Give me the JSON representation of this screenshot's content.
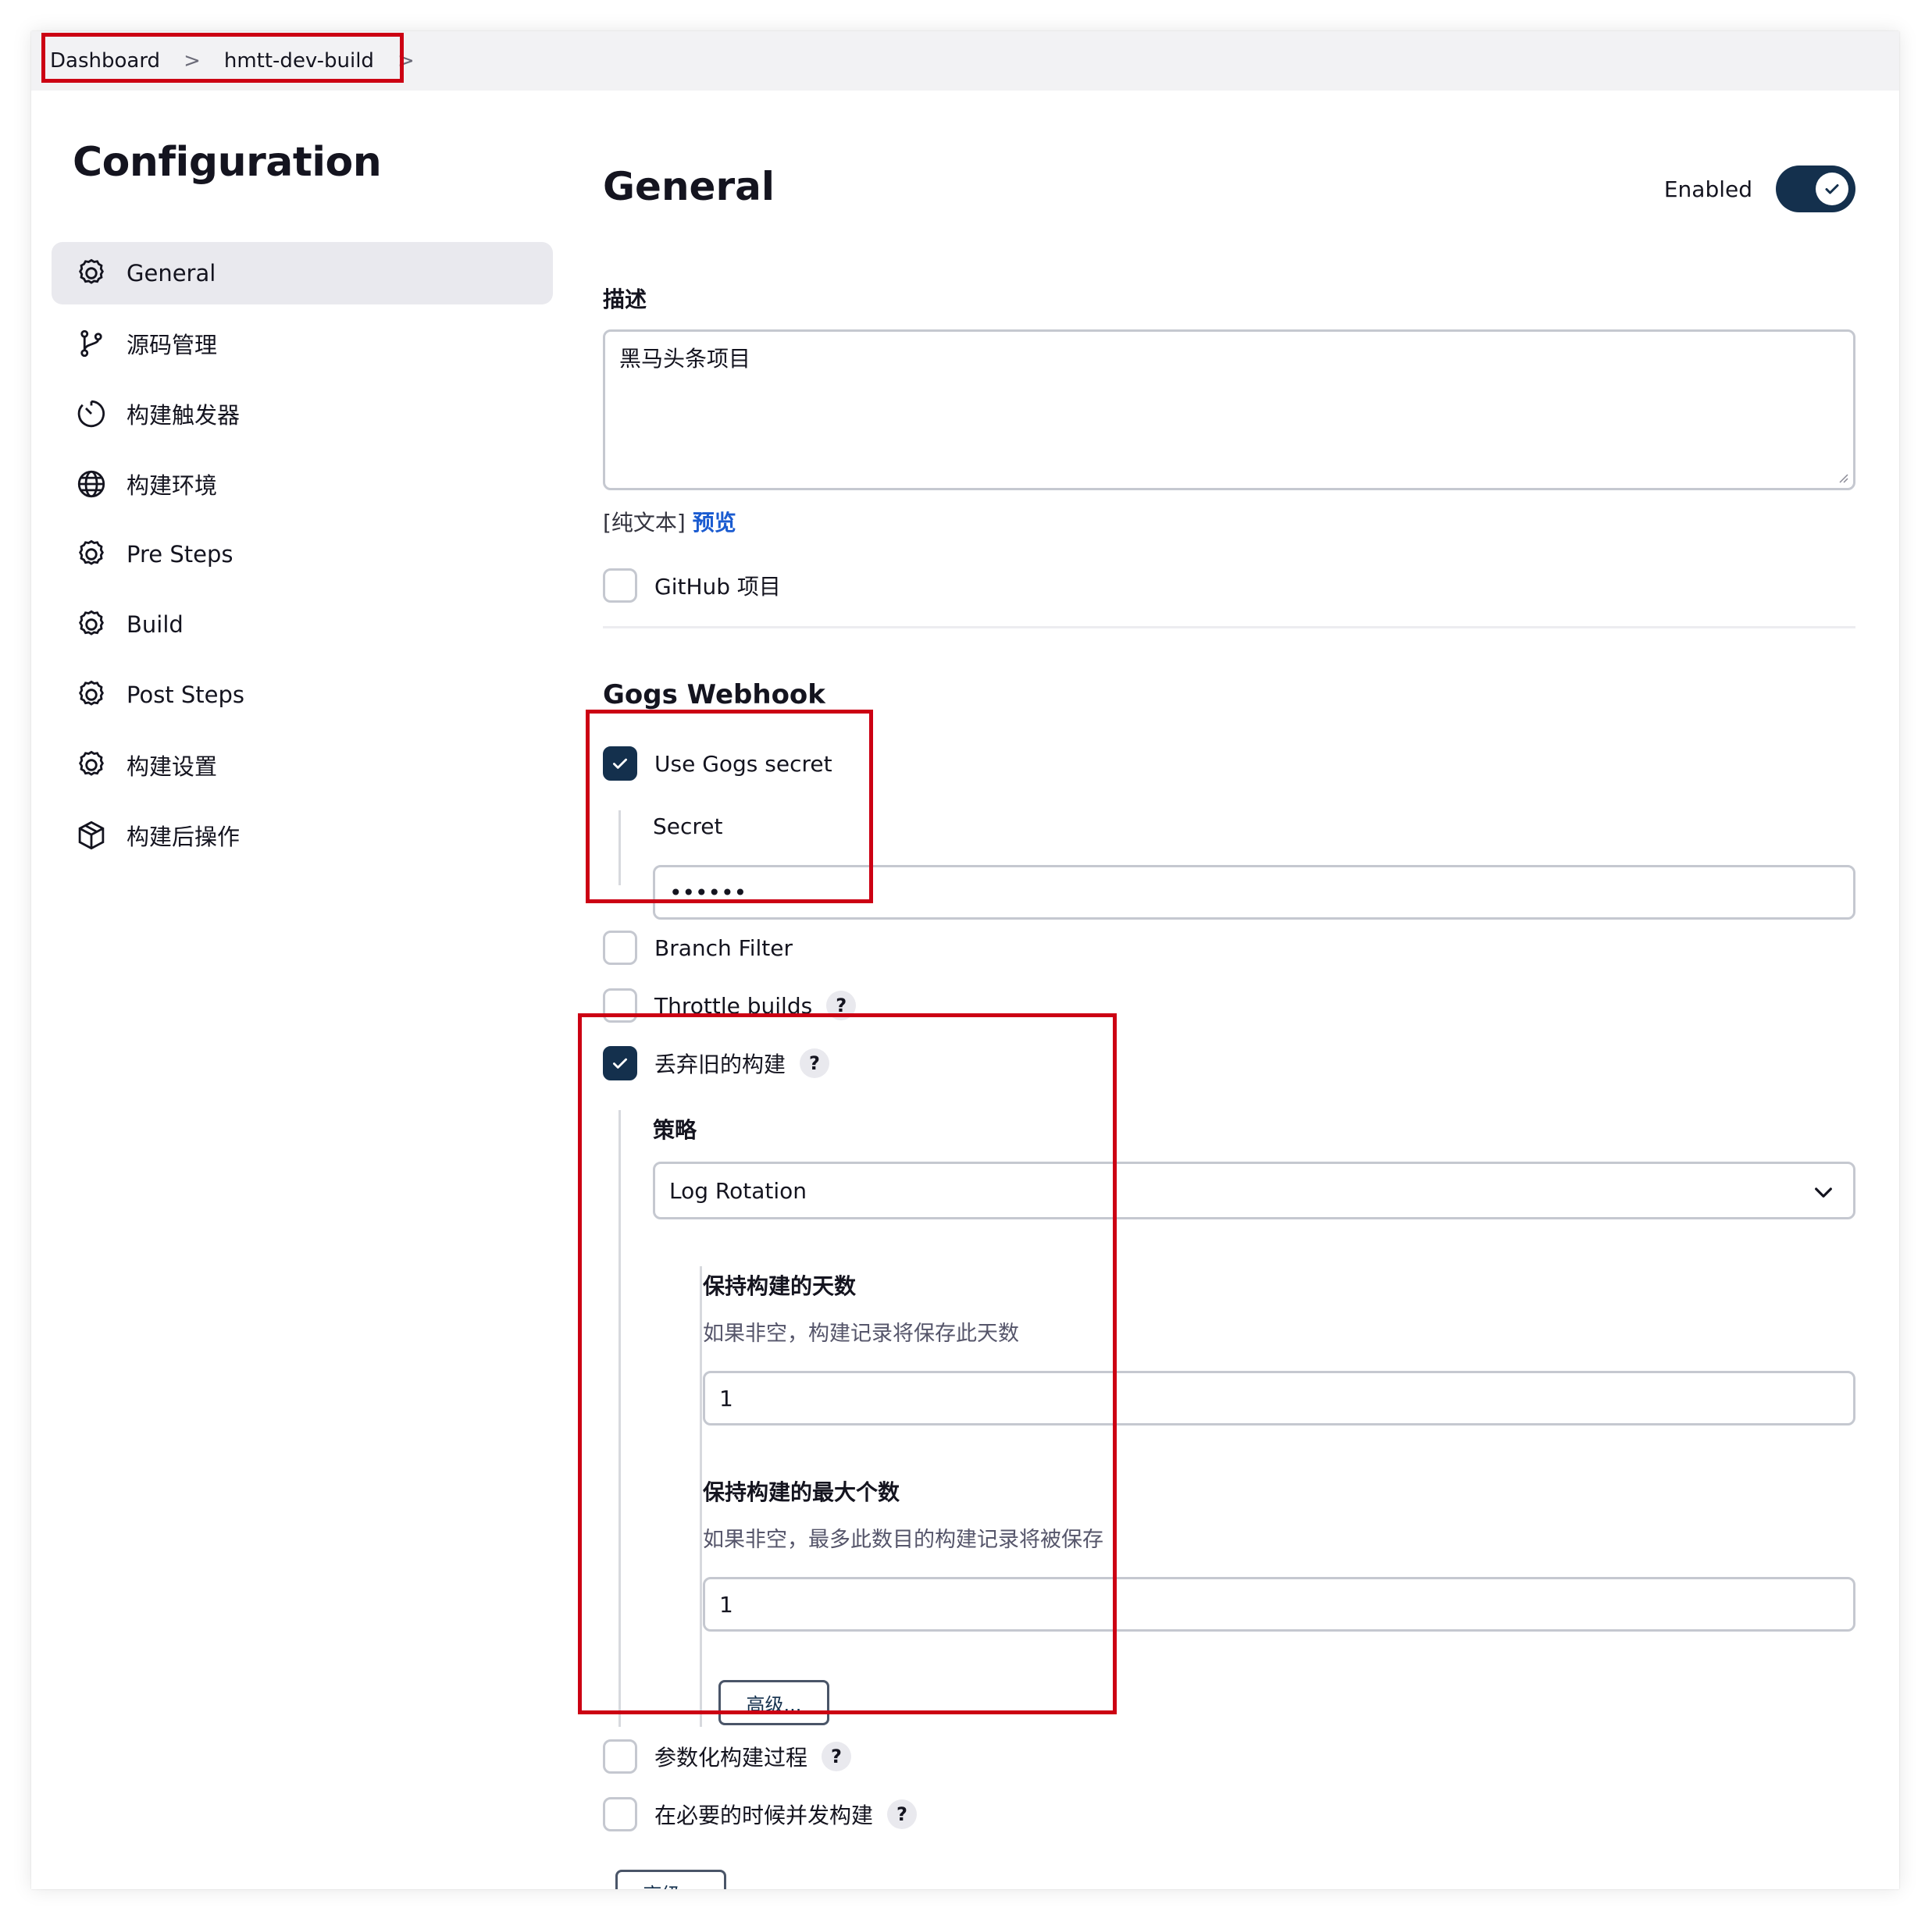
{
  "breadcrumb": {
    "items": [
      "Dashboard",
      "hmtt-dev-build"
    ],
    "separator": ">"
  },
  "sidebar": {
    "title": "Configuration",
    "items": [
      {
        "label": "General",
        "icon": "gear-icon",
        "active": true
      },
      {
        "label": "源码管理",
        "icon": "git-branch-icon"
      },
      {
        "label": "构建触发器",
        "icon": "timer-icon"
      },
      {
        "label": "构建环境",
        "icon": "globe-icon"
      },
      {
        "label": "Pre Steps",
        "icon": "gear-icon"
      },
      {
        "label": "Build",
        "icon": "gear-icon"
      },
      {
        "label": "Post Steps",
        "icon": "gear-icon"
      },
      {
        "label": "构建设置",
        "icon": "gear-icon"
      },
      {
        "label": "构建后操作",
        "icon": "package-icon"
      }
    ]
  },
  "main": {
    "title": "General",
    "enabled_label": "Enabled",
    "enabled": true,
    "description_label": "描述",
    "description_value": "黑马头条项目",
    "plain_text": "[纯文本]",
    "preview_link": "预览",
    "github_project": "GitHub 项目",
    "gogs_title": "Gogs Webhook",
    "use_gogs_secret": "Use Gogs secret",
    "secret_label": "Secret",
    "secret_value": "••••••",
    "branch_filter": "Branch Filter",
    "throttle_builds": "Throttle builds",
    "discard_old_builds": "丢弃旧的构建",
    "strategy_label": "策略",
    "strategy_value": "Log Rotation",
    "days_title": "保持构建的天数",
    "days_desc": "如果非空，构建记录将保存此天数",
    "days_value": "1",
    "max_title": "保持构建的最大个数",
    "max_desc": "如果非空，最多此数目的构建记录将被保存",
    "max_value": "1",
    "advanced_inner": "高级...",
    "parameterized": "参数化构建过程",
    "concurrent": "在必要的时候并发构建",
    "advanced_outer": "高级...",
    "help_symbol": "?"
  },
  "colors": {
    "accent": "#14304d",
    "highlight_box": "#cc0013",
    "link": "#1a5bd0"
  }
}
